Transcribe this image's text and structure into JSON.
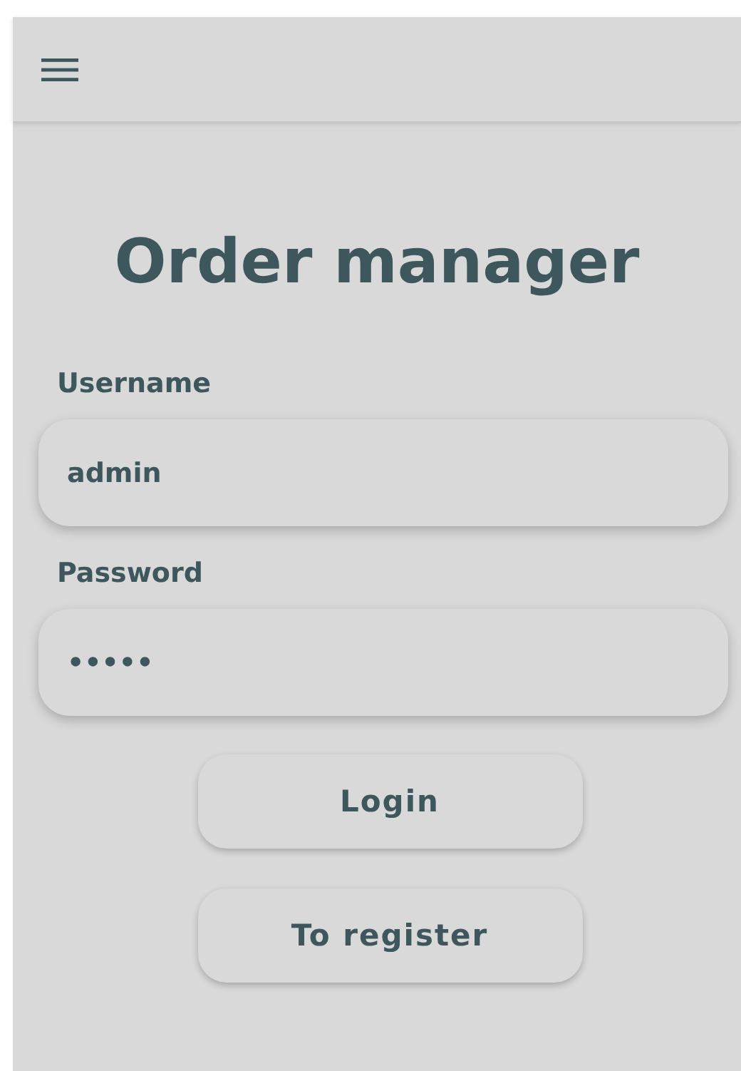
{
  "title": "Order manager",
  "fields": [
    {
      "label": "Username",
      "value": "admin"
    },
    {
      "label": "Password",
      "value": "•••••"
    }
  ],
  "buttons": [
    "Login",
    "To register"
  ]
}
